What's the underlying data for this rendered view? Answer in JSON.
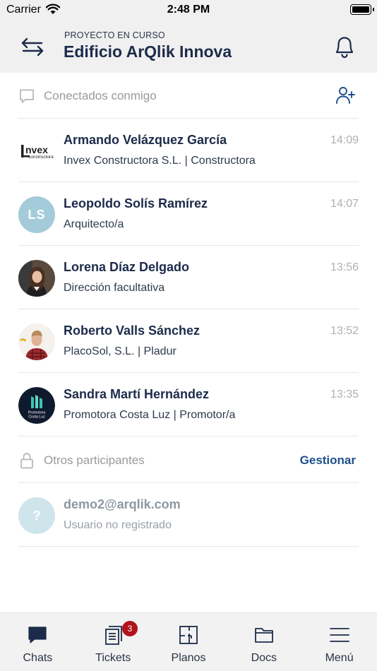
{
  "status_bar": {
    "carrier": "Carrier",
    "time": "2:48 PM"
  },
  "header": {
    "kicker": "PROYECTO EN CURSO",
    "title": "Edificio ArQlik Innova"
  },
  "connected_section": {
    "label": "Conectados conmigo"
  },
  "contacts": [
    {
      "name": "Armando Velázquez García",
      "subtitle": "Invex Constructora S.L. | Constructora",
      "time": "14:09",
      "avatar": "invex-logo",
      "logo_text": "nvex",
      "logo_sub": "constructora"
    },
    {
      "name": "Leopoldo Solís Ramírez",
      "subtitle": "Arquitecto/a",
      "time": "14:07",
      "avatar": "initials",
      "initials": "LS"
    },
    {
      "name": "Lorena Díaz Delgado",
      "subtitle": "Dirección facultativa",
      "time": "13:56",
      "avatar": "photo"
    },
    {
      "name": "Roberto Valls Sánchez",
      "subtitle": "PlacoSol, S.L. | Pladur",
      "time": "13:52",
      "avatar": "photo"
    },
    {
      "name": "Sandra Martí Hernández",
      "subtitle": "Promotora Costa Luz | Promotor/a",
      "time": "13:35",
      "avatar": "promotora-logo",
      "logo_line1": "Promotora",
      "logo_line2": "Costa Luz"
    }
  ],
  "others_section": {
    "label": "Otros participantes",
    "action": "Gestionar"
  },
  "unregistered": {
    "name": "demo2@arqlik.com",
    "subtitle": "Usuario no registrado",
    "initials": "?"
  },
  "tabs": [
    {
      "label": "Chats",
      "icon": "chat-bubble-icon"
    },
    {
      "label": "Tickets",
      "icon": "tickets-icon",
      "badge": "3"
    },
    {
      "label": "Planos",
      "icon": "floorplan-icon"
    },
    {
      "label": "Docs",
      "icon": "folder-icon"
    },
    {
      "label": "Menú",
      "icon": "hamburger-icon"
    }
  ],
  "colors": {
    "accent": "#1d4f8c",
    "title": "#1d2b4a",
    "badge": "#b1141a",
    "header_bg": "#f0f0f0"
  }
}
